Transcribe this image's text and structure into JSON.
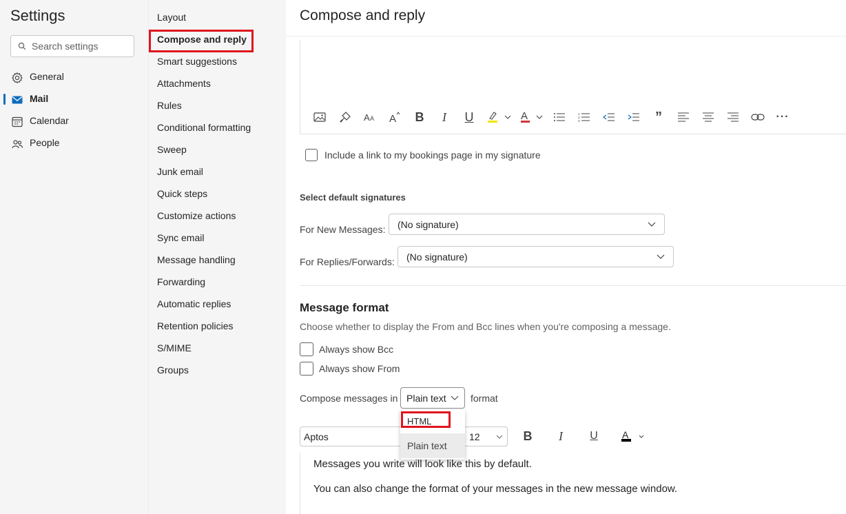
{
  "sidebar": {
    "title": "Settings",
    "search_placeholder": "Search settings",
    "items": [
      {
        "label": "General",
        "icon": "gear-icon"
      },
      {
        "label": "Mail",
        "icon": "mail-icon",
        "selected": true
      },
      {
        "label": "Calendar",
        "icon": "calendar-icon"
      },
      {
        "label": "People",
        "icon": "people-icon"
      }
    ]
  },
  "subnav": {
    "items": [
      "Layout",
      "Compose and reply",
      "Smart suggestions",
      "Attachments",
      "Rules",
      "Conditional formatting",
      "Sweep",
      "Junk email",
      "Quick steps",
      "Customize actions",
      "Sync email",
      "Message handling",
      "Forwarding",
      "Automatic replies",
      "Retention policies",
      "S/MIME",
      "Groups"
    ],
    "active": "Compose and reply"
  },
  "main": {
    "title": "Compose and reply",
    "toolbar_icons": [
      "insert-picture-icon",
      "format-painter-icon",
      "font-size-icon",
      "grow-font-icon",
      "bold-icon",
      "italic-icon",
      "underline-icon",
      "highlight-icon",
      "font-color-icon",
      "bullets-icon",
      "numbering-icon",
      "decrease-indent-icon",
      "increase-indent-icon",
      "quote-icon",
      "align-left-icon",
      "align-center-icon",
      "align-right-icon",
      "link-icon",
      "more-icon"
    ],
    "bookings_label": "Include a link to my bookings page in my signature",
    "default_sigs": {
      "title": "Select default signatures",
      "new_label": "For New Messages:",
      "new_value": "(No signature)",
      "reply_label": "For Replies/Forwards:",
      "reply_value": "(No signature)"
    },
    "message_format": {
      "title": "Message format",
      "description": "Choose whether to display the From and Bcc lines when you're composing a message.",
      "bcc_label": "Always show Bcc",
      "from_label": "Always show From",
      "compose_label": "Compose messages in",
      "selected_format": "Plain text",
      "format_suffix": "format",
      "options": [
        "HTML",
        "Plain text"
      ],
      "font": "Aptos",
      "size": "12",
      "preview_line1": "Messages you write will look like this by default.",
      "preview_line2": "You can also change the format of your messages in the new message window."
    }
  },
  "colors": {
    "accent": "#0f6cbd",
    "highlight_box": "#e0141e",
    "highlighter_yellow": "#f2e600",
    "font_red": "#d13438"
  }
}
